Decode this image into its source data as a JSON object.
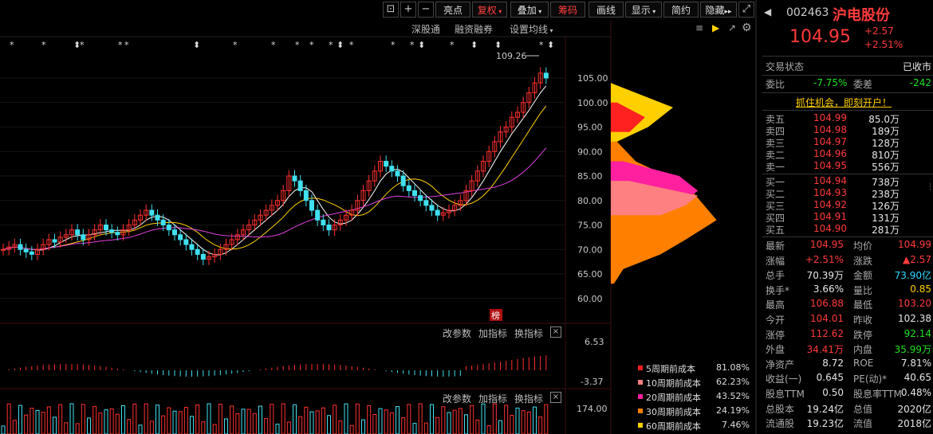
{
  "toolbar": {
    "buttons": [
      {
        "label": "亮点",
        "active": false
      },
      {
        "label": "复权",
        "active": true
      },
      {
        "label": "叠加",
        "active": false
      },
      {
        "label": "筹码",
        "active": true
      },
      {
        "label": "画线",
        "active": false
      },
      {
        "label": "显示",
        "active": false
      },
      {
        "label": "简约",
        "active": false
      },
      {
        "label": "隐藏",
        "active": false
      }
    ],
    "icons": [
      "lock-icon",
      "plus-icon",
      "minus-icon",
      "fullscreen-icon"
    ]
  },
  "main_chart": {
    "sub_links": [
      "深股通",
      "融资融券",
      "设置均线"
    ],
    "high_annotation": "109.26",
    "price_ticks": [
      "105.00",
      "100.00",
      "95.00",
      "90.00",
      "85.00",
      "80.00",
      "75.00",
      "70.00",
      "65.00",
      "60.00"
    ],
    "badge": "榜"
  },
  "macd": {
    "links": [
      "改参数",
      "加指标",
      "换指标"
    ],
    "ticks": [
      "6.53",
      "-3.37"
    ]
  },
  "vol": {
    "links": [
      "改参数",
      "加指标",
      "换指标"
    ],
    "ticks": [
      "174.00"
    ]
  },
  "chips_legend": [
    {
      "name": "5周期前成本",
      "pct": "81.08%",
      "color": "#ff2020"
    },
    {
      "name": "10周期前成本",
      "pct": "62.23%",
      "color": "#ff8080"
    },
    {
      "name": "20周期前成本",
      "pct": "43.52%",
      "color": "#ff20a0"
    },
    {
      "name": "30周期前成本",
      "pct": "24.19%",
      "color": "#ff8000"
    },
    {
      "name": "60周期前成本",
      "pct": "7.46%",
      "color": "#ffd000"
    }
  ],
  "quote": {
    "code": "002463",
    "name": "沪电股份",
    "price": "104.95",
    "change": "+2.57",
    "change_pct": "+2.51%",
    "status_label": "交易状态",
    "status_value": "已收市",
    "webi_label": "委比",
    "webi_value": "-7.75%",
    "weicha_label": "委差",
    "weicha_value": "-242",
    "promo": "抓住机会，即刻开户！",
    "asks": [
      {
        "label": "卖五",
        "price": "104.99",
        "vol": "85.0万"
      },
      {
        "label": "卖四",
        "price": "104.98",
        "vol": "189万"
      },
      {
        "label": "卖三",
        "price": "104.97",
        "vol": "128万"
      },
      {
        "label": "卖二",
        "price": "104.96",
        "vol": "810万"
      },
      {
        "label": "卖一",
        "price": "104.95",
        "vol": "556万"
      }
    ],
    "bids": [
      {
        "label": "买一",
        "price": "104.94",
        "vol": "738万"
      },
      {
        "label": "买二",
        "price": "104.93",
        "vol": "238万"
      },
      {
        "label": "买三",
        "price": "104.92",
        "vol": "126万"
      },
      {
        "label": "买四",
        "price": "104.91",
        "vol": "131万"
      },
      {
        "label": "买五",
        "price": "104.90",
        "vol": "281万"
      }
    ],
    "stats": [
      {
        "l1": "最新",
        "v1": "104.95",
        "c1": "red",
        "l2": "均价",
        "v2": "104.99",
        "c2": "red"
      },
      {
        "l1": "涨幅",
        "v1": "+2.51%",
        "c1": "red",
        "l2": "涨跌",
        "v2": "▲2.57",
        "c2": "red"
      },
      {
        "l1": "总手",
        "v1": "70.39万",
        "c1": "white",
        "l2": "金额",
        "v2": "73.90亿",
        "c2": "cyan"
      },
      {
        "l1": "换手*",
        "v1": "3.66%",
        "c1": "white",
        "l2": "量比",
        "v2": "0.85",
        "c2": "yellow"
      },
      {
        "l1": "最高",
        "v1": "106.88",
        "c1": "red",
        "l2": "最低",
        "v2": "103.20",
        "c2": "red"
      },
      {
        "l1": "今开",
        "v1": "104.01",
        "c1": "red",
        "l2": "昨收",
        "v2": "102.38",
        "c2": "white"
      },
      {
        "l1": "涨停",
        "v1": "112.62",
        "c1": "red",
        "l2": "跌停",
        "v2": "92.14",
        "c2": "green"
      },
      {
        "l1": "外盘",
        "v1": "34.41万",
        "c1": "red",
        "l2": "内盘",
        "v2": "35.99万",
        "c2": "green"
      },
      {
        "l1": "净资产",
        "v1": "8.72",
        "c1": "white",
        "l2": "ROE",
        "v2": "7.81%",
        "c2": "white"
      },
      {
        "l1": "收益(一)",
        "v1": "0.645",
        "c1": "white",
        "l2": "PE(动)*",
        "v2": "40.65",
        "c2": "white"
      },
      {
        "l1": "股息TTM",
        "v1": "0.50",
        "c1": "white",
        "l2": "股息率TTM",
        "v2": "0.48%",
        "c2": "white"
      },
      {
        "l1": "总股本",
        "v1": "19.24亿",
        "c1": "white",
        "l2": "总值",
        "v2": "2020亿",
        "c2": "white"
      },
      {
        "l1": "流通股",
        "v1": "19.23亿",
        "c1": "white",
        "l2": "流值",
        "v2": "2018亿",
        "c2": "white"
      }
    ]
  }
}
